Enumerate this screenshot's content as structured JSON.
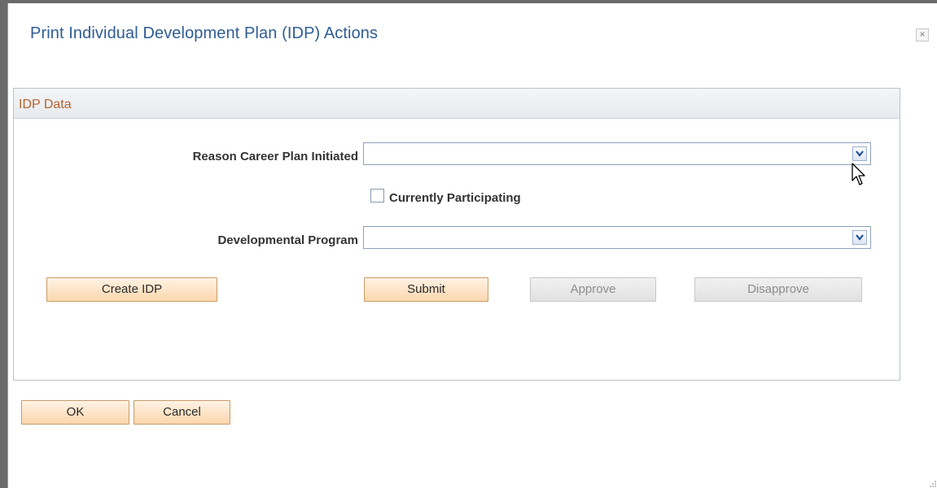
{
  "dialog": {
    "title": "Print Individual Development Plan (IDP) Actions",
    "close_glyph": "×"
  },
  "group": {
    "title": "IDP Data"
  },
  "fields": {
    "reason_label": "Reason Career Plan Initiated",
    "reason_value": "",
    "currently_participating_label": "Currently Participating",
    "currently_participating_checked": false,
    "program_label": "Developmental Program",
    "program_value": ""
  },
  "buttons": {
    "create_idp": "Create IDP",
    "submit": "Submit",
    "approve": "Approve",
    "disapprove": "Disapprove",
    "ok": "OK",
    "cancel": "Cancel"
  },
  "icons": {
    "close": "close-icon",
    "dropdown": "chevron-down-icon",
    "cursor": "mouse-pointer-icon",
    "resize": "resize-grip-icon"
  },
  "colors": {
    "title": "#2f5d94",
    "group_title": "#b4632c",
    "primary_button": "#fbd7ad",
    "disabled_button": "#e1e1e1"
  }
}
